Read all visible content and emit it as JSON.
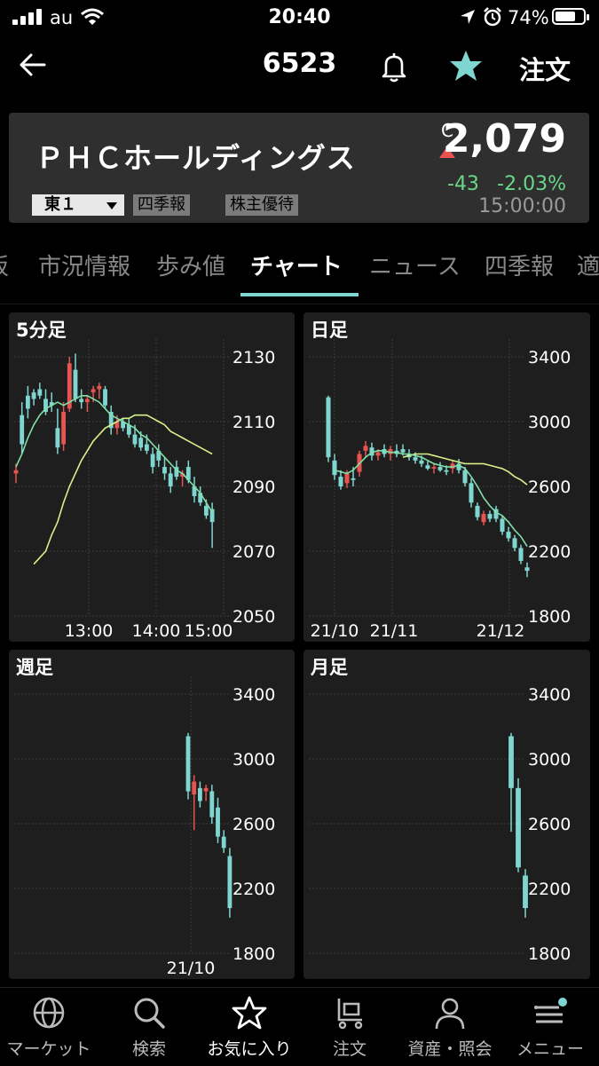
{
  "status_bar": {
    "carrier": "au",
    "time": "20:40",
    "battery": "74%",
    "battery_level": 0.74
  },
  "nav": {
    "code": "6523",
    "order_label": "注文"
  },
  "quote": {
    "company": "ＰＨＣホールディングス",
    "c_mark": "C",
    "price": "2,079",
    "change": "-43",
    "change_pct": "-2.03%",
    "time": "15:00:00",
    "market": "東１",
    "tags": [
      "四季報",
      "株主優待"
    ]
  },
  "tabs": [
    "板",
    "市況情報",
    "歩み値",
    "チャート",
    "ニュース",
    "四季報",
    "適"
  ],
  "active_tab": "チャート",
  "colors": {
    "up": "#e8544f",
    "down": "#7fd6d1",
    "ma_short": "#7fe0a8",
    "ma_long": "#d8f08a",
    "accent": "#7fd6d1"
  },
  "charts": {
    "min5": {
      "title": "5分足",
      "y_ticks": [
        "2130",
        "2110",
        "2090",
        "2070",
        "2050"
      ],
      "x_ticks": [
        "13:00",
        "14:00",
        "15:00"
      ]
    },
    "daily": {
      "title": "日足",
      "y_ticks": [
        "3400",
        "3000",
        "2600",
        "2200",
        "1800"
      ],
      "x_ticks": [
        "21/10",
        "21/11",
        "21/12"
      ]
    },
    "weekly": {
      "title": "週足",
      "y_ticks": [
        "3400",
        "3000",
        "2600",
        "2200",
        "1800"
      ],
      "x_ticks": [
        "21/10"
      ]
    },
    "monthly": {
      "title": "月足",
      "y_ticks": [
        "3400",
        "3000",
        "2600",
        "2200",
        "1800"
      ],
      "x_ticks": []
    }
  },
  "chart_data": [
    {
      "type": "candlestick",
      "title": "5分足",
      "x_ticks": [
        "13:00",
        "14:00",
        "15:00"
      ],
      "ylim": [
        2050,
        2130
      ],
      "candles": [
        {
          "o": 2094,
          "h": 2097,
          "l": 2091,
          "c": 2095
        },
        {
          "o": 2112,
          "h": 2116,
          "l": 2100,
          "c": 2103
        },
        {
          "o": 2118,
          "h": 2121,
          "l": 2111,
          "c": 2114
        },
        {
          "o": 2119,
          "h": 2120,
          "l": 2115,
          "c": 2117
        },
        {
          "o": 2120,
          "h": 2122,
          "l": 2117,
          "c": 2118
        },
        {
          "o": 2117,
          "h": 2120,
          "l": 2112,
          "c": 2113
        },
        {
          "o": 2116,
          "h": 2119,
          "l": 2113,
          "c": 2115
        },
        {
          "o": 2108,
          "h": 2114,
          "l": 2100,
          "c": 2102
        },
        {
          "o": 2103,
          "h": 2116,
          "l": 2101,
          "c": 2113
        },
        {
          "o": 2114,
          "h": 2130,
          "l": 2113,
          "c": 2128
        },
        {
          "o": 2126,
          "h": 2131,
          "l": 2116,
          "c": 2117
        },
        {
          "o": 2117,
          "h": 2120,
          "l": 2114,
          "c": 2116
        },
        {
          "o": 2116,
          "h": 2118,
          "l": 2113,
          "c": 2117
        },
        {
          "o": 2119,
          "h": 2121,
          "l": 2116,
          "c": 2120
        },
        {
          "o": 2120,
          "h": 2122,
          "l": 2117,
          "c": 2121
        },
        {
          "o": 2120,
          "h": 2121,
          "l": 2114,
          "c": 2115
        },
        {
          "o": 2113,
          "h": 2115,
          "l": 2106,
          "c": 2108
        },
        {
          "o": 2108,
          "h": 2112,
          "l": 2106,
          "c": 2110
        },
        {
          "o": 2110,
          "h": 2111,
          "l": 2107,
          "c": 2108
        },
        {
          "o": 2109,
          "h": 2111,
          "l": 2105,
          "c": 2106
        },
        {
          "o": 2106,
          "h": 2109,
          "l": 2102,
          "c": 2103
        },
        {
          "o": 2105,
          "h": 2107,
          "l": 2101,
          "c": 2102
        },
        {
          "o": 2103,
          "h": 2106,
          "l": 2100,
          "c": 2101
        },
        {
          "o": 2100,
          "h": 2102,
          "l": 2094,
          "c": 2096
        },
        {
          "o": 2101,
          "h": 2103,
          "l": 2096,
          "c": 2098
        },
        {
          "o": 2096,
          "h": 2099,
          "l": 2092,
          "c": 2094
        },
        {
          "o": 2094,
          "h": 2096,
          "l": 2088,
          "c": 2090
        },
        {
          "o": 2096,
          "h": 2098,
          "l": 2092,
          "c": 2093
        },
        {
          "o": 2093,
          "h": 2095,
          "l": 2090,
          "c": 2094
        },
        {
          "o": 2096,
          "h": 2098,
          "l": 2091,
          "c": 2092
        },
        {
          "o": 2090,
          "h": 2093,
          "l": 2085,
          "c": 2087
        },
        {
          "o": 2088,
          "h": 2090,
          "l": 2084,
          "c": 2085
        },
        {
          "o": 2084,
          "h": 2086,
          "l": 2080,
          "c": 2081
        },
        {
          "o": 2083,
          "h": 2085,
          "l": 2071,
          "c": 2079
        }
      ],
      "ma_short": [
        2096,
        2100,
        2105,
        2109,
        2112,
        2114,
        2115,
        2116,
        2115,
        2116,
        2117,
        2118,
        2118,
        2117,
        2116,
        2114,
        2112,
        2111,
        2110,
        2109,
        2108,
        2106,
        2105,
        2103,
        2101,
        2099,
        2097,
        2095,
        2094,
        2092,
        2090,
        2088,
        2085,
        2082
      ],
      "ma_long": [
        2066,
        2068,
        2070,
        2075,
        2079,
        2085,
        2090,
        2094,
        2098,
        2101,
        2104,
        2106,
        2108,
        2109,
        2110,
        2111,
        2111,
        2112,
        2112,
        2112,
        2111,
        2110,
        2109,
        2107,
        2106,
        2105,
        2104,
        2103,
        2102,
        2101,
        2100
      ]
    },
    {
      "type": "candlestick",
      "title": "日足",
      "x_ticks": [
        "21/10",
        "21/11",
        "21/12"
      ],
      "ylim": [
        1800,
        3400
      ],
      "candles": [
        {
          "o": 3150,
          "h": 3160,
          "l": 2750,
          "c": 2780
        },
        {
          "o": 2760,
          "h": 2800,
          "l": 2640,
          "c": 2670
        },
        {
          "o": 2660,
          "h": 2700,
          "l": 2580,
          "c": 2600
        },
        {
          "o": 2620,
          "h": 2700,
          "l": 2590,
          "c": 2680
        },
        {
          "o": 2650,
          "h": 2720,
          "l": 2600,
          "c": 2640
        },
        {
          "o": 2690,
          "h": 2820,
          "l": 2660,
          "c": 2800
        },
        {
          "o": 2820,
          "h": 2880,
          "l": 2780,
          "c": 2850
        },
        {
          "o": 2840,
          "h": 2870,
          "l": 2760,
          "c": 2790
        },
        {
          "o": 2790,
          "h": 2830,
          "l": 2760,
          "c": 2810
        },
        {
          "o": 2830,
          "h": 2860,
          "l": 2780,
          "c": 2800
        },
        {
          "o": 2800,
          "h": 2850,
          "l": 2760,
          "c": 2830
        },
        {
          "o": 2820,
          "h": 2860,
          "l": 2780,
          "c": 2800
        },
        {
          "o": 2830,
          "h": 2860,
          "l": 2790,
          "c": 2810
        },
        {
          "o": 2800,
          "h": 2830,
          "l": 2760,
          "c": 2780
        },
        {
          "o": 2780,
          "h": 2810,
          "l": 2740,
          "c": 2760
        },
        {
          "o": 2760,
          "h": 2790,
          "l": 2720,
          "c": 2740
        },
        {
          "o": 2730,
          "h": 2760,
          "l": 2700,
          "c": 2710
        },
        {
          "o": 2710,
          "h": 2740,
          "l": 2680,
          "c": 2720
        },
        {
          "o": 2720,
          "h": 2750,
          "l": 2690,
          "c": 2700
        },
        {
          "o": 2700,
          "h": 2730,
          "l": 2670,
          "c": 2690
        },
        {
          "o": 2710,
          "h": 2760,
          "l": 2680,
          "c": 2740
        },
        {
          "o": 2740,
          "h": 2770,
          "l": 2680,
          "c": 2700
        },
        {
          "o": 2700,
          "h": 2720,
          "l": 2600,
          "c": 2620
        },
        {
          "o": 2620,
          "h": 2650,
          "l": 2470,
          "c": 2500
        },
        {
          "o": 2480,
          "h": 2500,
          "l": 2390,
          "c": 2410
        },
        {
          "o": 2380,
          "h": 2450,
          "l": 2360,
          "c": 2430
        },
        {
          "o": 2430,
          "h": 2450,
          "l": 2380,
          "c": 2400
        },
        {
          "o": 2460,
          "h": 2480,
          "l": 2380,
          "c": 2400
        },
        {
          "o": 2400,
          "h": 2420,
          "l": 2300,
          "c": 2320
        },
        {
          "o": 2320,
          "h": 2350,
          "l": 2260,
          "c": 2280
        },
        {
          "o": 2280,
          "h": 2300,
          "l": 2200,
          "c": 2220
        },
        {
          "o": 2220,
          "h": 2240,
          "l": 2120,
          "c": 2140
        },
        {
          "o": 2100,
          "h": 2130,
          "l": 2040,
          "c": 2079
        }
      ],
      "ma_short": [
        2700,
        2690,
        2680,
        2700,
        2740,
        2780,
        2810,
        2820,
        2820,
        2810,
        2810,
        2800,
        2800,
        2790,
        2780,
        2760,
        2740,
        2730,
        2720,
        2720,
        2730,
        2710,
        2660,
        2600,
        2530,
        2480,
        2440,
        2420,
        2380,
        2330,
        2290,
        2230
      ],
      "ma_long": [
        2780,
        2790,
        2800,
        2800,
        2800,
        2790,
        2780,
        2770,
        2760,
        2750,
        2740,
        2740,
        2740,
        2740,
        2730,
        2720,
        2710,
        2690,
        2660,
        2640,
        2610
      ]
    },
    {
      "type": "candlestick",
      "title": "週足",
      "x_ticks": [
        "21/10"
      ],
      "ylim": [
        1800,
        3400
      ],
      "candles": [
        {
          "o": 3140,
          "h": 3160,
          "l": 2750,
          "c": 2800
        },
        {
          "o": 2780,
          "h": 2900,
          "l": 2560,
          "c": 2860
        },
        {
          "o": 2820,
          "h": 2860,
          "l": 2700,
          "c": 2740
        },
        {
          "o": 2800,
          "h": 2840,
          "l": 2740,
          "c": 2820
        },
        {
          "o": 2800,
          "h": 2840,
          "l": 2600,
          "c": 2640
        },
        {
          "o": 2700,
          "h": 2760,
          "l": 2480,
          "c": 2520
        },
        {
          "o": 2520,
          "h": 2560,
          "l": 2420,
          "c": 2450
        },
        {
          "o": 2400,
          "h": 2450,
          "l": 2020,
          "c": 2079
        }
      ]
    },
    {
      "type": "candlestick",
      "title": "月足",
      "x_ticks": [],
      "ylim": [
        1800,
        3400
      ],
      "candles": [
        {
          "o": 3140,
          "h": 3160,
          "l": 2550,
          "c": 2820
        },
        {
          "o": 2820,
          "h": 2880,
          "l": 2300,
          "c": 2330
        },
        {
          "o": 2280,
          "h": 2320,
          "l": 2020,
          "c": 2079
        }
      ]
    }
  ],
  "bottom_nav": [
    {
      "label": "マーケット",
      "icon": "globe-icon"
    },
    {
      "label": "検索",
      "icon": "search-icon"
    },
    {
      "label": "お気に入り",
      "icon": "star-icon"
    },
    {
      "label": "注文",
      "icon": "cart-icon"
    },
    {
      "label": "資産・照会",
      "icon": "person-icon"
    },
    {
      "label": "メニュー",
      "icon": "menu-icon"
    }
  ],
  "active_bottom": 2
}
